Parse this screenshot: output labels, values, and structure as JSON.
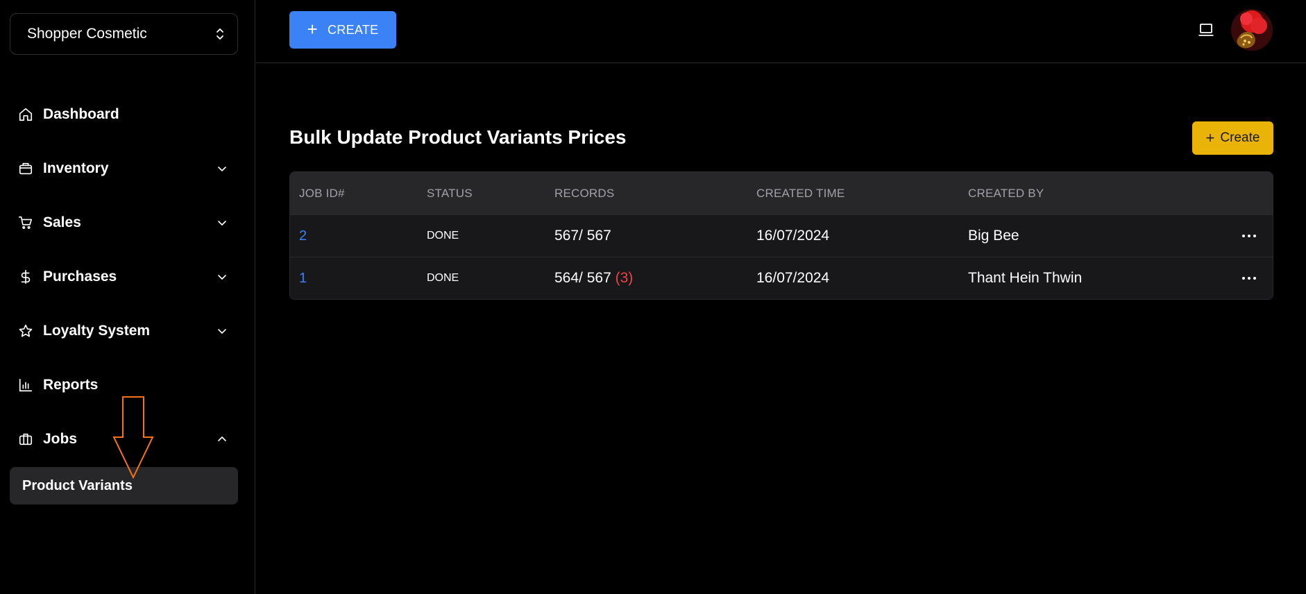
{
  "sidebar": {
    "shop_name": "Shopper Cosmetic",
    "items": [
      {
        "label": "Dashboard",
        "icon": "home-icon",
        "expandable": false
      },
      {
        "label": "Inventory",
        "icon": "package-icon",
        "expandable": true
      },
      {
        "label": "Sales",
        "icon": "cart-icon",
        "expandable": true
      },
      {
        "label": "Purchases",
        "icon": "dollar-icon",
        "expandable": true
      },
      {
        "label": "Loyalty System",
        "icon": "star-icon",
        "expandable": true
      },
      {
        "label": "Reports",
        "icon": "bar-chart-icon",
        "expandable": false
      },
      {
        "label": "Jobs",
        "icon": "briefcase-icon",
        "expandable": true,
        "expanded": true
      }
    ],
    "sub_item": "Product Variants"
  },
  "topbar": {
    "create_label": "CREATE"
  },
  "main": {
    "title": "Bulk Update Product Variants Prices",
    "create_label": "Create",
    "table": {
      "headers": [
        "JOB ID#",
        "STATUS",
        "RECORDS",
        "CREATED TIME",
        "CREATED BY"
      ],
      "rows": [
        {
          "id": "2",
          "status": "DONE",
          "records": "567/ 567",
          "failed": "",
          "created_time": "16/07/2024",
          "created_by": "Big Bee"
        },
        {
          "id": "1",
          "status": "DONE",
          "records": "564/ 567",
          "failed": "(3)",
          "created_time": "16/07/2024",
          "created_by": "Thant Hein Thwin"
        }
      ]
    }
  },
  "colors": {
    "primary": "#3b82f6",
    "warning": "#eab308",
    "danger": "#ef4444",
    "annotation": "#f97316"
  }
}
